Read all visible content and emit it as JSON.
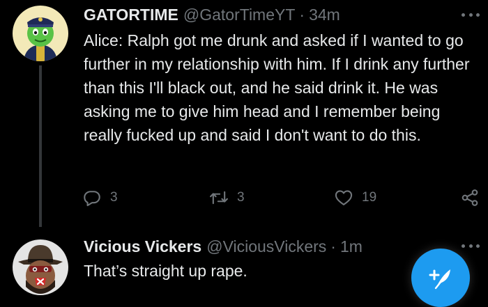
{
  "tweets": [
    {
      "display_name": "GATORTIME",
      "handle": "@GatorTimeYT",
      "separator": "·",
      "time": "34m",
      "text": "Alice: Ralph got me drunk and asked if I wanted to go further in my relationship with him. If I drink any further than this I'll black out, and he said drink it. He was asking me to give him head and I remember being really fucked up and said I don't want to do this.",
      "actions": {
        "reply_count": "3",
        "retweet_count": "3",
        "like_count": "19"
      }
    },
    {
      "display_name": "Vicious Vickers",
      "handle": "@ViciousVickers",
      "separator": "·",
      "time": "1m",
      "text": "That’s straight up rape."
    }
  ],
  "icons": {
    "reply": "reply-icon",
    "retweet": "retweet-icon",
    "like": "heart-icon",
    "share": "share-icon",
    "more": "more-icon",
    "compose": "compose-tweet-icon"
  },
  "colors": {
    "background": "#000000",
    "text": "#e7e9ea",
    "secondary": "#71767b",
    "accent": "#1d9bf0"
  }
}
